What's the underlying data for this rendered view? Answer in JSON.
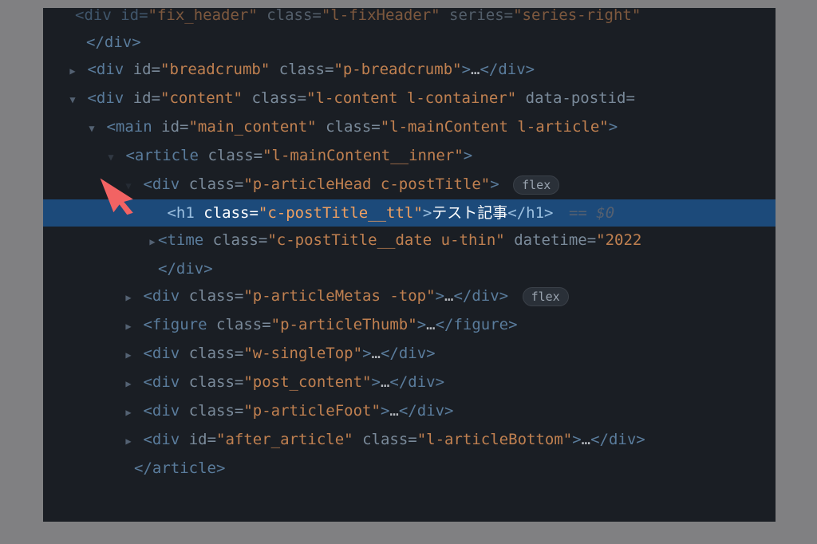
{
  "pointer_color": "#f26363",
  "line0_partial": "…",
  "line1": "</div>",
  "line2": {
    "tag": "div",
    "id_attr": "id",
    "id_val": "\"breadcrumb\"",
    "class_attr": "class",
    "class_val": "\"p-breadcrumb\"",
    "ellipsis": "…",
    "close": "</div>"
  },
  "line3": {
    "tag": "div",
    "id_attr": "id",
    "id_val": "\"content\"",
    "class_attr": "class",
    "class_val": "\"l-content l-container\"",
    "data_attr": "data-postid"
  },
  "line4": {
    "tag": "main",
    "id_attr": "id",
    "id_val": "\"main_content\"",
    "class_attr": "class",
    "class_val": "\"l-mainContent l-article\""
  },
  "line5": {
    "tag": "article",
    "class_attr": "class",
    "class_val": "\"l-mainContent__inner\""
  },
  "line6": {
    "tag": "div",
    "class_attr": "class",
    "class_val": "\"p-articleHead c-postTitle\"",
    "badge": "flex"
  },
  "line7": {
    "tag": "h1",
    "class_attr": "class",
    "class_val": "\"c-postTitle__ttl\"",
    "text": "テスト記事",
    "close": "</h1>",
    "eq": "== ",
    "dollar": "$0"
  },
  "line8": {
    "tag": "time",
    "class_attr": "class",
    "class_val": "\"c-postTitle__date u-thin\"",
    "dt_attr": "datetime",
    "dt_val": "\"2022"
  },
  "line9": "</div>",
  "line10": {
    "tag": "div",
    "class_attr": "class",
    "class_val": "\"p-articleMetas -top\"",
    "ellipsis": "…",
    "close": "</div>",
    "badge": "flex"
  },
  "line11": {
    "prefix": "<",
    "tag": "figure",
    "class_attr": "class",
    "class_val": "\"p-articleThumb\"",
    "ellipsis": "…",
    "close": "</figure>"
  },
  "line12": {
    "tag": "div",
    "class_attr": "class",
    "class_val": "\"w-singleTop\"",
    "ellipsis": "…",
    "close": "</div>"
  },
  "line13": {
    "tag": "div",
    "class_attr": "class",
    "class_val": "\"post_content\"",
    "ellipsis": "…",
    "close": "</div>"
  },
  "line14": {
    "tag": "div",
    "class_attr": "class",
    "class_val": "\"p-articleFoot\"",
    "ellipsis": "…",
    "close": "</div>"
  },
  "line15": {
    "tag": "div",
    "id_attr": "id",
    "id_val": "\"after_article\"",
    "class_attr": "class",
    "class_val": "\"l-articleBottom\"",
    "ellipsis": "…",
    "close": "</div>"
  },
  "line16": "</article>"
}
